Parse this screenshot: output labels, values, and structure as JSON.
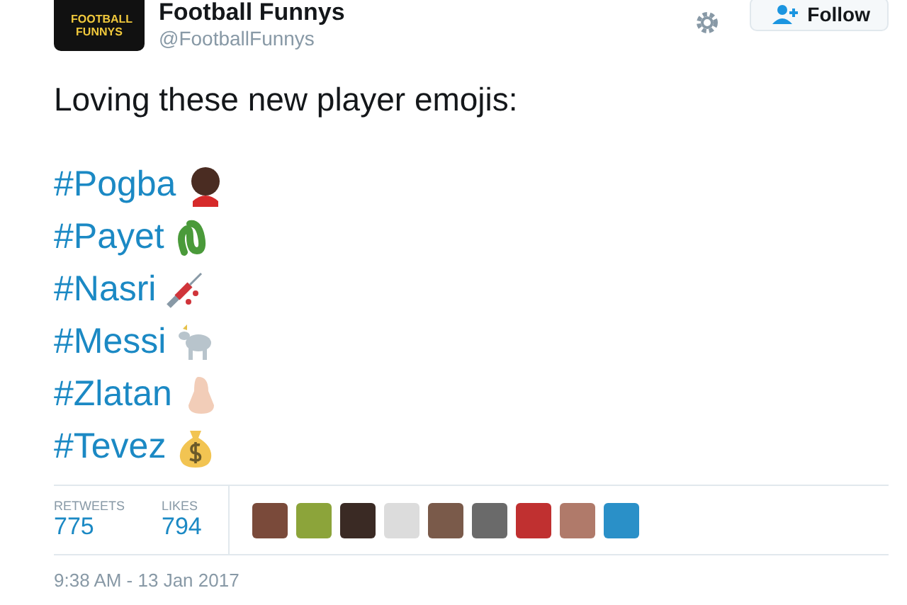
{
  "author": {
    "name": "Football Funnys",
    "handle": "@FootballFunnys",
    "avatar_text": "FOOTBALL FUNNYS"
  },
  "follow_button": {
    "label": "Follow"
  },
  "text": "Loving these new player emojis:",
  "hashtags": [
    {
      "tag": "#Pogba",
      "kind": "face"
    },
    {
      "tag": "#Payet",
      "kind": "snake"
    },
    {
      "tag": "#Nasri",
      "kind": "syringe"
    },
    {
      "tag": "#Messi",
      "kind": "goat"
    },
    {
      "tag": "#Zlatan",
      "kind": "nose"
    },
    {
      "tag": "#Tevez",
      "kind": "moneybag"
    }
  ],
  "stats": [
    {
      "label": "RETWEETS",
      "value": "775"
    },
    {
      "label": "LIKES",
      "value": "794"
    }
  ],
  "timestamp": "9:38 AM - 13 Jan 2017"
}
